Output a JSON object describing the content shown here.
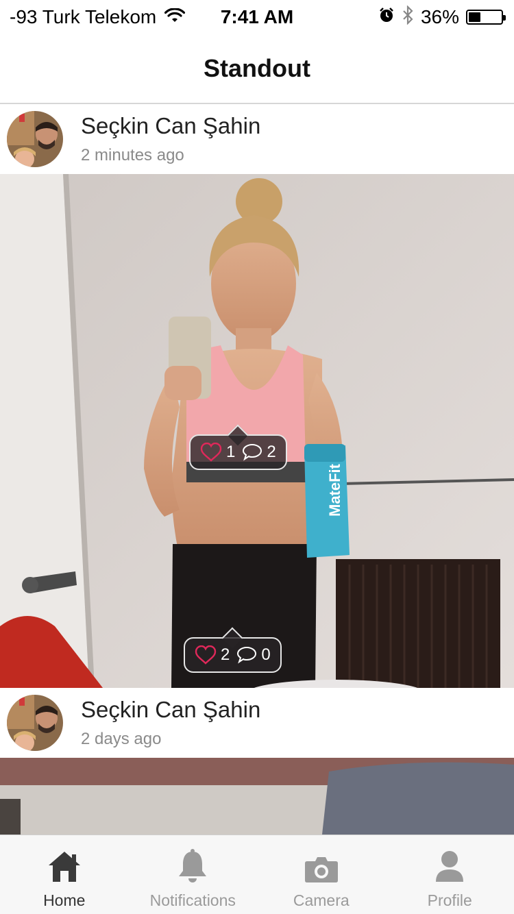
{
  "status": {
    "carrier": "-93 Turk Telekom",
    "time": "7:41 AM",
    "battery": "36%",
    "battery_level": 0.36
  },
  "nav": {
    "title": "Standout"
  },
  "posts": [
    {
      "author": "Seçkin Can Şahin",
      "time": "2 minutes ago",
      "tags": [
        {
          "likes": "1",
          "comments": "2"
        },
        {
          "likes": "2",
          "comments": "0"
        }
      ]
    },
    {
      "author": "Seçkin Can Şahin",
      "time": "2 days ago"
    }
  ],
  "tabs": [
    {
      "label": "Home",
      "icon": "home-icon",
      "active": true
    },
    {
      "label": "Notifications",
      "icon": "bell-icon",
      "active": false
    },
    {
      "label": "Camera",
      "icon": "camera-icon",
      "active": false
    },
    {
      "label": "Profile",
      "icon": "profile-icon",
      "active": false
    }
  ],
  "colors": {
    "heart": "#e0285a",
    "tab_active": "#333333",
    "tab_inactive": "#9a9a9a"
  },
  "photo_text": "MateFit"
}
